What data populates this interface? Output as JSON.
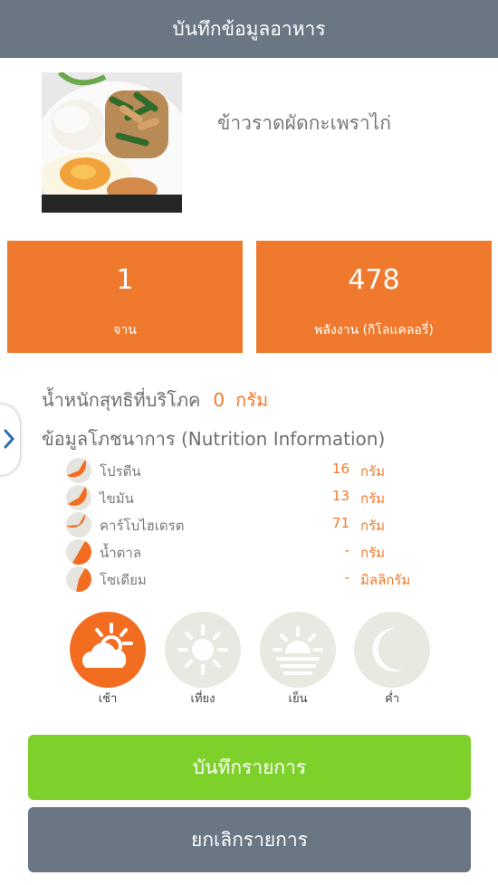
{
  "header": {
    "title": "บันทึกข้อมูลอาหาร"
  },
  "food": {
    "name": "ข้าวราดผัดกะเพราไก่",
    "image": "food-photo"
  },
  "stats": {
    "plates": {
      "value": "1",
      "unit": "จาน"
    },
    "energy": {
      "value": "478",
      "unit": "พลังงาน (กิโลแคลอรี่)"
    }
  },
  "net_weight": {
    "label": "น้ำหนักสุทธิที่บริโภค",
    "value": "0",
    "unit": "กรัม"
  },
  "nutrition": {
    "title": "ข้อมูลโภชนาการ (Nutrition Information)",
    "items": [
      {
        "name": "โปรตีน",
        "value": "16",
        "unit": "กรัม",
        "fill": 0.6
      },
      {
        "name": "ไขมัน",
        "value": "13",
        "unit": "กรัม",
        "fill": 0.55
      },
      {
        "name": "คาร์โบไฮเดรต",
        "value": "71",
        "unit": "กรัม",
        "fill": 0.65
      },
      {
        "name": "น้ำตาล",
        "value": "-",
        "unit": "กรัม",
        "fill": 0.5
      },
      {
        "name": "โซเดียม",
        "value": "-",
        "unit": "มิลลิกรัม",
        "fill": 0.45
      }
    ]
  },
  "meals": [
    {
      "label": "เช้า",
      "icon": "sunrise-cloud-icon",
      "active": true
    },
    {
      "label": "เที่ยง",
      "icon": "sun-icon",
      "active": false
    },
    {
      "label": "เย็น",
      "icon": "sunset-icon",
      "active": false
    },
    {
      "label": "ค่ำ",
      "icon": "moon-icon",
      "active": false
    }
  ],
  "buttons": {
    "save": "บันทึกรายการ",
    "cancel": "ยกเลิกรายการ"
  },
  "colors": {
    "header": "#6b7685",
    "accent": "#ef7a2e",
    "save": "#7ed12b",
    "meal_bg": "#e9e8e1"
  }
}
